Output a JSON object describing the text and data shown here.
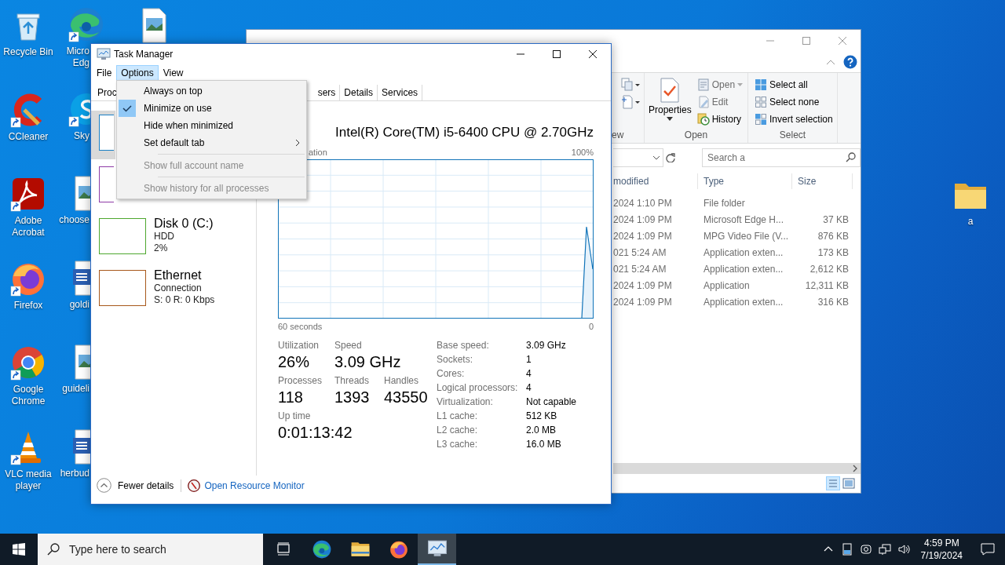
{
  "desktop": {
    "icons_column_1": [
      {
        "label": "Recycle Bin",
        "kind": "recycle-bin",
        "shortcut": false
      },
      {
        "label": "CCleaner",
        "kind": "cleaner",
        "shortcut": true
      },
      {
        "label": "Adobe Acrobat",
        "kind": "pdf",
        "shortcut": true
      },
      {
        "label": "Firefox",
        "kind": "firefox",
        "shortcut": true
      },
      {
        "label": "Google Chrome",
        "kind": "chrome",
        "shortcut": true
      },
      {
        "label": "VLC media player",
        "kind": "cone",
        "shortcut": true
      }
    ],
    "icons_column_2": [
      {
        "label": "Micro Edg",
        "kind": "edge",
        "shortcut": true
      },
      {
        "label": "Sky",
        "kind": "chat",
        "shortcut": true
      },
      {
        "label": "choose",
        "kind": "image-file",
        "shortcut": false
      },
      {
        "label": "goldi",
        "kind": "word",
        "shortcut": false
      },
      {
        "label": "guideli",
        "kind": "image-file",
        "shortcut": false
      },
      {
        "label": "herbud",
        "kind": "word",
        "shortcut": false
      }
    ],
    "icons_column_3": [
      {
        "kind": "image-file",
        "shortcut": false
      }
    ],
    "icons_right": [
      {
        "label": "a",
        "kind": "folder",
        "shortcut": false
      }
    ]
  },
  "explorer": {
    "ribbon": {
      "groups": [
        {
          "label": "ew",
          "kind": "new"
        },
        {
          "label": "Open",
          "kind": "open"
        },
        {
          "label": "Select",
          "kind": "select"
        }
      ],
      "properties": {
        "label": "Properties"
      },
      "open_items": [
        {
          "label": "Open",
          "kind": "open",
          "disabled": true,
          "dropdown": true
        },
        {
          "label": "Edit",
          "kind": "edit",
          "disabled": true,
          "dropdown": false
        },
        {
          "label": "History",
          "kind": "history",
          "disabled": false,
          "dropdown": false
        }
      ],
      "select_items": [
        {
          "label": "Select all",
          "kind": "all"
        },
        {
          "label": "Select none",
          "kind": "none"
        },
        {
          "label": "Invert selection",
          "kind": "invert"
        }
      ]
    },
    "search": {
      "placeholder": "Search a"
    },
    "columns": [
      "modified",
      "Type",
      "Size"
    ],
    "rows": [
      {
        "modified": "2024 1:10 PM",
        "type": "File folder"
      },
      {
        "modified": "2024 1:09 PM",
        "type": "Microsoft Edge H...",
        "size": "37 KB"
      },
      {
        "modified": "2024 1:09 PM",
        "type": "MPG Video File (V...",
        "size": "876 KB"
      },
      {
        "modified": "021 5:24 AM",
        "type": "Application exten...",
        "size": "173 KB"
      },
      {
        "modified": "021 5:24 AM",
        "type": "Application exten...",
        "size": "2,612 KB"
      },
      {
        "modified": "2024 1:09 PM",
        "type": "Application",
        "size": "12,311 KB"
      },
      {
        "modified": "2024 1:09 PM",
        "type": "Application exten...",
        "size": "316 KB"
      }
    ]
  },
  "task_manager": {
    "title": "Task Manager",
    "menu": [
      {
        "label": "File",
        "selected": false
      },
      {
        "label": "Options",
        "selected": true
      },
      {
        "label": "View",
        "selected": false
      }
    ],
    "tabs": [
      {
        "label": "Proc",
        "selected": false
      },
      {
        "label": "sers",
        "selected": false
      },
      {
        "label": "Details",
        "selected": false
      },
      {
        "label": "Services",
        "selected": false
      }
    ],
    "resources": [
      {
        "selected": true,
        "color": "#1a7fc4"
      },
      {
        "selected": false,
        "color": "#8e3aa6"
      },
      {
        "title": "Disk 0 (C:)",
        "subtitle": "HDD",
        "reading": "2%",
        "selected": false,
        "color": "#4ea72e"
      },
      {
        "title": "Ethernet",
        "subtitle": "Connection",
        "reading": "S: 0 R: 0 Kbps",
        "selected": false,
        "color": "#a7581b"
      }
    ],
    "processor": "Intel(R) Core(TM) i5-6400 CPU @ 2.70GHz",
    "graph": {
      "label": "ation",
      "max_label": "100%",
      "time_label": "60 seconds",
      "min_label": "0"
    },
    "stat_rows": [
      [
        {
          "label": "Utilization",
          "value": "26%"
        },
        {
          "label": "Speed",
          "value": "3.09 GHz"
        }
      ],
      [
        {
          "label": "Processes",
          "value": "118"
        },
        {
          "label": "Threads",
          "value": "1393"
        },
        {
          "label": "Handles",
          "value": "43550"
        }
      ],
      [
        {
          "label": "Up time",
          "value": "0:01:13:42"
        }
      ]
    ],
    "details": [
      {
        "label": "Base speed:",
        "value": "3.09 GHz"
      },
      {
        "label": "Sockets:",
        "value": "1"
      },
      {
        "label": "Cores:",
        "value": "4"
      },
      {
        "label": "Logical processors:",
        "value": "4"
      },
      {
        "label": "Virtualization:",
        "value": "Not capable"
      },
      {
        "label": "L1 cache:",
        "value": "512 KB"
      },
      {
        "label": "L2 cache:",
        "value": "2.0 MB"
      },
      {
        "label": "L3 cache:",
        "value": "16.0 MB"
      }
    ],
    "footer": {
      "fewer_details": "Fewer details",
      "resource_monitor": "Open Resource Monitor"
    },
    "options_menu": [
      {
        "label": "Always on top",
        "kind": "check",
        "checked": false,
        "disabled": false
      },
      {
        "label": "Minimize on use",
        "kind": "check",
        "checked": true,
        "disabled": false
      },
      {
        "label": "Hide when minimized",
        "kind": "check",
        "checked": false,
        "disabled": false
      },
      {
        "label": "Set default tab",
        "kind": "submenu",
        "disabled": false
      },
      {
        "kind": "separator"
      },
      {
        "label": "Show full account name",
        "kind": "check",
        "checked": false,
        "disabled": true
      },
      {
        "kind": "separator"
      },
      {
        "label": "Show history for all processes",
        "kind": "check",
        "checked": false,
        "disabled": true
      }
    ]
  },
  "taskbar": {
    "search": {
      "placeholder": "Type here to search"
    },
    "apps": [
      {
        "kind": "task-view",
        "selected": false
      },
      {
        "kind": "edge",
        "selected": false
      },
      {
        "kind": "explorer",
        "selected": false
      },
      {
        "kind": "firefox",
        "selected": false
      },
      {
        "kind": "task-manager",
        "selected": true
      }
    ],
    "tray": {
      "time": "4:59 PM",
      "date": "7/19/2024"
    }
  }
}
